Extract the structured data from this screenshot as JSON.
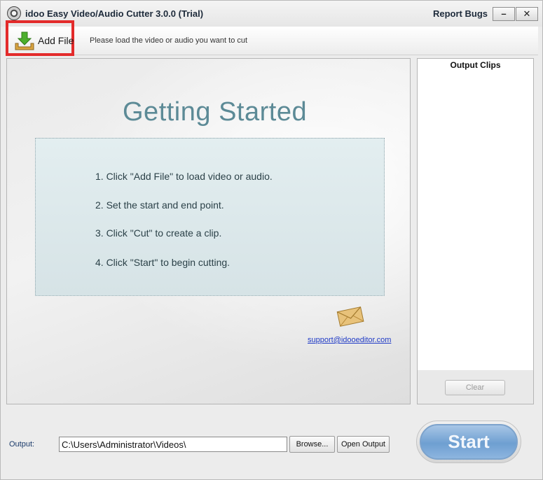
{
  "window": {
    "title": "idoo Easy Video/Audio Cutter 3.0.0 (Trial)",
    "report_bugs": "Report Bugs",
    "minimize_label": "–",
    "close_label": "✕"
  },
  "toolbar": {
    "add_file_label": "Add File",
    "hint": "Please load the video or audio you want to cut",
    "highlight_color": "#e32b2b"
  },
  "main": {
    "heading": "Getting Started",
    "steps": [
      "1. Click \"Add File\" to load video or audio.",
      "2. Set the start and end point.",
      "3. Click \"Cut\" to create a clip.",
      "4. Click \"Start\" to begin cutting."
    ],
    "support_email": "support@idooeditor.com",
    "envelope_icon": "envelope-icon"
  },
  "clips": {
    "title": "Output Clips",
    "clear_label": "Clear"
  },
  "bottom": {
    "output_label": "Output:",
    "output_path": "C:\\Users\\Administrator\\Videos\\",
    "browse_label": "Browse...",
    "open_output_label": "Open Output",
    "start_label": "Start"
  }
}
